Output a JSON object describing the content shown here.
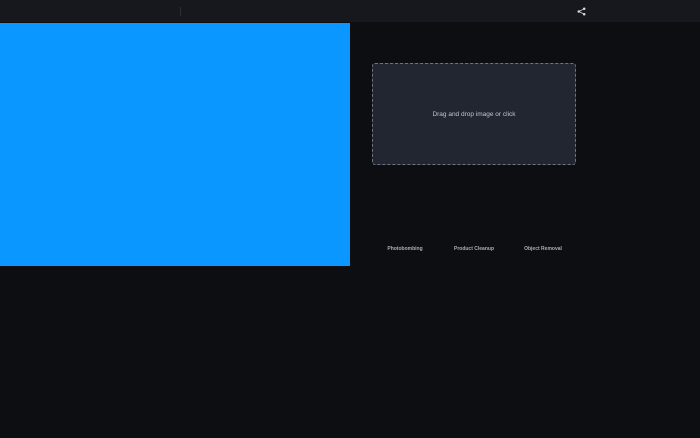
{
  "header": {
    "share_icon": "share-icon"
  },
  "preview": {
    "color": "#0a97ff"
  },
  "dropzone": {
    "text": "Drag and drop image or click"
  },
  "examples": [
    {
      "label": "Photobombing"
    },
    {
      "label": "Product Cleanup"
    },
    {
      "label": "Object Removal"
    }
  ]
}
